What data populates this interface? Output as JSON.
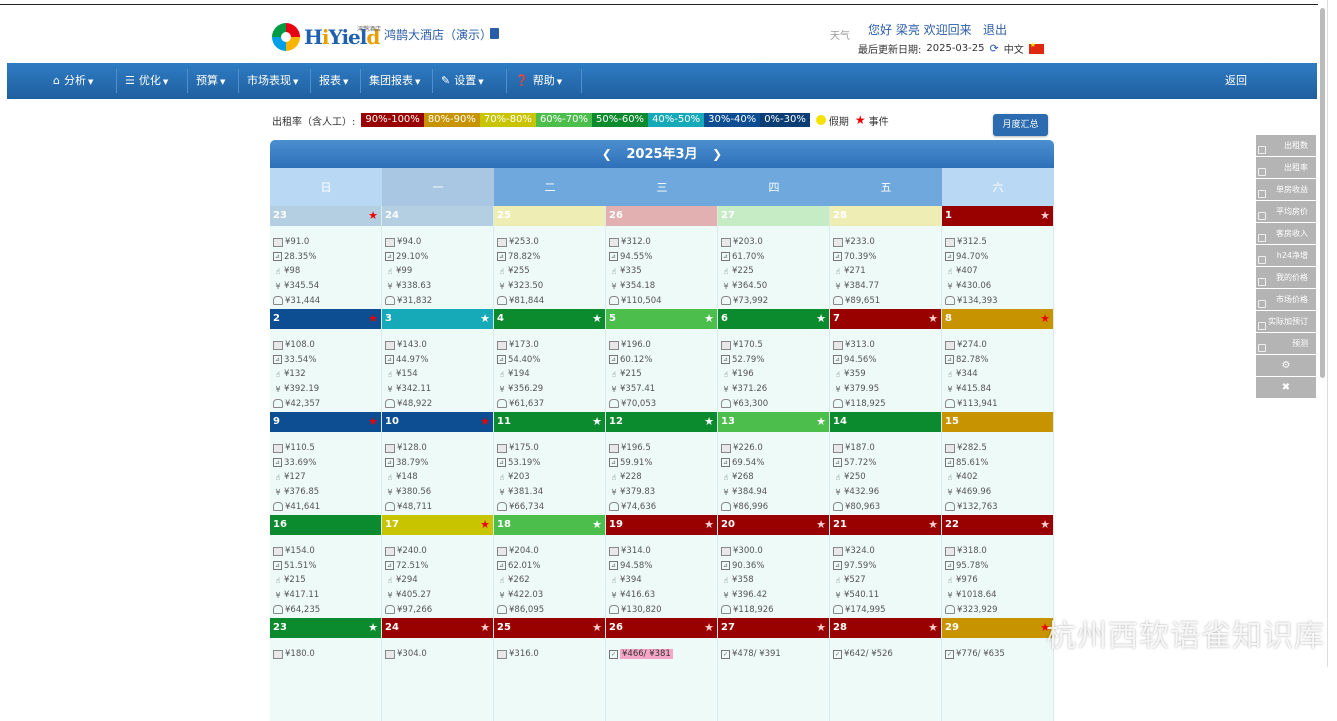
{
  "header": {
    "logo_text_a": "H",
    "logo_text_b": "i",
    "logo_text_c": "Yiel",
    "logo_text_d": "d",
    "logo_sub": "鸿鹊酒店",
    "hotel_name": "鸿鹊大酒店（演示）",
    "weather": "天气",
    "greeting": "您好 梁亮 欢迎回来",
    "logout": "退出",
    "update_label": "最后更新日期:",
    "update_date": "2025-03-25",
    "language": "中文"
  },
  "nav": {
    "items": [
      {
        "label": "分析",
        "icon": "home-icon",
        "glyph": "⌂"
      },
      {
        "label": "优化",
        "icon": "list-icon",
        "glyph": "☰"
      },
      {
        "label": "预算",
        "icon": "",
        "glyph": ""
      },
      {
        "label": "市场表现",
        "icon": "",
        "glyph": ""
      },
      {
        "label": "报表",
        "icon": "",
        "glyph": ""
      },
      {
        "label": "集团报表",
        "icon": "",
        "glyph": ""
      },
      {
        "label": "设置",
        "icon": "wrench-icon",
        "glyph": "✎"
      },
      {
        "label": "帮助",
        "icon": "question-icon",
        "glyph": "❓"
      }
    ],
    "back": "返回"
  },
  "legend": {
    "label": "出租率（含人工）:",
    "ranges": [
      {
        "label": "90%-100%",
        "color": "#990000"
      },
      {
        "label": "80%-90%",
        "color": "#c79400"
      },
      {
        "label": "70%-80%",
        "color": "#c9c400"
      },
      {
        "label": "60%-70%",
        "color": "#4cbe4c"
      },
      {
        "label": "50%-60%",
        "color": "#0b8a2e"
      },
      {
        "label": "40%-50%",
        "color": "#16a9b8"
      },
      {
        "label": "30%-40%",
        "color": "#0d4e93"
      },
      {
        "label": "0%-30%",
        "color": "#0a3d74"
      }
    ],
    "holiday": "假期",
    "event": "事件"
  },
  "month_summary": "月度汇总",
  "calendar": {
    "title": "2025年3月",
    "weekdays": [
      {
        "label": "日",
        "color": "#b9d8f3"
      },
      {
        "label": "一",
        "color": "#a9c6e2"
      },
      {
        "label": "二",
        "color": "#6fa8dc"
      },
      {
        "label": "三",
        "color": "#6fa8dc"
      },
      {
        "label": "四",
        "color": "#6fa8dc"
      },
      {
        "label": "五",
        "color": "#6fa8dc"
      },
      {
        "label": "六",
        "color": "#b9d8f3"
      }
    ],
    "days": [
      {
        "day": "23",
        "color": "#b4cfe2",
        "star": true,
        "dim": true,
        "l": [
          "¥91.0",
          "28.35%",
          "¥98",
          "¥345.54",
          "¥31,444"
        ]
      },
      {
        "day": "24",
        "color": "#b4cfe2",
        "star": false,
        "dim": true,
        "l": [
          "¥94.0",
          "29.10%",
          "¥99",
          "¥338.63",
          "¥31,832"
        ]
      },
      {
        "day": "25",
        "color": "#eeeeb4",
        "star": false,
        "dim": true,
        "l": [
          "¥253.0",
          "78.82%",
          "¥255",
          "¥323.50",
          "¥81,844"
        ]
      },
      {
        "day": "26",
        "color": "#e2b0b0",
        "star": false,
        "dim": true,
        "l": [
          "¥312.0",
          "94.55%",
          "¥335",
          "¥354.18",
          "¥110,504"
        ]
      },
      {
        "day": "27",
        "color": "#c6ecc6",
        "star": false,
        "dim": true,
        "l": [
          "¥203.0",
          "61.70%",
          "¥225",
          "¥364.50",
          "¥73,992"
        ]
      },
      {
        "day": "28",
        "color": "#eeeeb4",
        "star": false,
        "dim": true,
        "l": [
          "¥233.0",
          "70.39%",
          "¥271",
          "¥384.77",
          "¥89,651"
        ]
      },
      {
        "day": "1",
        "color": "#990000",
        "star": true,
        "l": [
          "¥312.5",
          "94.70%",
          "¥407",
          "¥430.06",
          "¥134,393"
        ]
      },
      {
        "day": "2",
        "color": "#0d4e93",
        "star": true,
        "l": [
          "¥108.0",
          "33.54%",
          "¥132",
          "¥392.19",
          "¥42,357"
        ]
      },
      {
        "day": "3",
        "color": "#16a9b8",
        "star": true,
        "l": [
          "¥143.0",
          "44.97%",
          "¥154",
          "¥342.11",
          "¥48,922"
        ]
      },
      {
        "day": "4",
        "color": "#0b8a2e",
        "star": true,
        "l": [
          "¥173.0",
          "54.40%",
          "¥194",
          "¥356.29",
          "¥61,637"
        ]
      },
      {
        "day": "5",
        "color": "#4cbe4c",
        "star": true,
        "l": [
          "¥196.0",
          "60.12%",
          "¥215",
          "¥357.41",
          "¥70,053"
        ]
      },
      {
        "day": "6",
        "color": "#0b8a2e",
        "star": true,
        "l": [
          "¥170.5",
          "52.79%",
          "¥196",
          "¥371.26",
          "¥63,300"
        ]
      },
      {
        "day": "7",
        "color": "#990000",
        "star": true,
        "l": [
          "¥313.0",
          "94.56%",
          "¥359",
          "¥379.95",
          "¥118,925"
        ]
      },
      {
        "day": "8",
        "color": "#c79400",
        "star": true,
        "l": [
          "¥274.0",
          "82.78%",
          "¥344",
          "¥415.84",
          "¥113,941"
        ]
      },
      {
        "day": "9",
        "color": "#0d4e93",
        "star": true,
        "l": [
          "¥110.5",
          "33.69%",
          "¥127",
          "¥376.85",
          "¥41,641"
        ]
      },
      {
        "day": "10",
        "color": "#0d4e93",
        "star": true,
        "l": [
          "¥128.0",
          "38.79%",
          "¥148",
          "¥380.56",
          "¥48,711"
        ]
      },
      {
        "day": "11",
        "color": "#0b8a2e",
        "star": true,
        "l": [
          "¥175.0",
          "53.19%",
          "¥203",
          "¥381.34",
          "¥66,734"
        ]
      },
      {
        "day": "12",
        "color": "#0b8a2e",
        "star": true,
        "l": [
          "¥196.5",
          "59.91%",
          "¥228",
          "¥379.83",
          "¥74,636"
        ]
      },
      {
        "day": "13",
        "color": "#4cbe4c",
        "star": true,
        "l": [
          "¥226.0",
          "69.54%",
          "¥268",
          "¥384.94",
          "¥86,996"
        ]
      },
      {
        "day": "14",
        "color": "#0b8a2e",
        "star": false,
        "l": [
          "¥187.0",
          "57.72%",
          "¥250",
          "¥432.96",
          "¥80,963"
        ]
      },
      {
        "day": "15",
        "color": "#c79400",
        "star": false,
        "l": [
          "¥282.5",
          "85.61%",
          "¥402",
          "¥469.96",
          "¥132,763"
        ]
      },
      {
        "day": "16",
        "color": "#0b8a2e",
        "star": false,
        "l": [
          "¥154.0",
          "51.51%",
          "¥215",
          "¥417.11",
          "¥64,235"
        ]
      },
      {
        "day": "17",
        "color": "#c9c400",
        "star": true,
        "l": [
          "¥240.0",
          "72.51%",
          "¥294",
          "¥405.27",
          "¥97,266"
        ]
      },
      {
        "day": "18",
        "color": "#4cbe4c",
        "star": true,
        "l": [
          "¥204.0",
          "62.01%",
          "¥262",
          "¥422.03",
          "¥86,095"
        ]
      },
      {
        "day": "19",
        "color": "#990000",
        "star": true,
        "l": [
          "¥314.0",
          "94.58%",
          "¥394",
          "¥416.63",
          "¥130,820"
        ]
      },
      {
        "day": "20",
        "color": "#990000",
        "star": true,
        "l": [
          "¥300.0",
          "90.36%",
          "¥358",
          "¥396.42",
          "¥118,926"
        ]
      },
      {
        "day": "21",
        "color": "#990000",
        "star": true,
        "l": [
          "¥324.0",
          "97.59%",
          "¥527",
          "¥540.11",
          "¥174,995"
        ]
      },
      {
        "day": "22",
        "color": "#990000",
        "star": true,
        "l": [
          "¥318.0",
          "95.78%",
          "¥976",
          "¥1018.64",
          "¥323,929"
        ]
      },
      {
        "day": "23",
        "color": "#0b8a2e",
        "star": true,
        "l": [
          "¥180.0"
        ]
      },
      {
        "day": "24",
        "color": "#990000",
        "star": true,
        "l": [
          "¥304.0"
        ]
      },
      {
        "day": "25",
        "color": "#990000",
        "star": true,
        "l": [
          "¥316.0"
        ]
      },
      {
        "day": "26",
        "color": "#990000",
        "star": true,
        "l": [
          "¥466/ ¥381"
        ],
        "pink": true,
        "box": true
      },
      {
        "day": "27",
        "color": "#990000",
        "star": true,
        "l": [
          "¥478/ ¥391"
        ],
        "box": true
      },
      {
        "day": "28",
        "color": "#990000",
        "star": true,
        "l": [
          "¥642/ ¥526"
        ],
        "box": true
      },
      {
        "day": "29",
        "color": "#c79400",
        "star": true,
        "l": [
          "¥776/ ¥635"
        ],
        "box": true
      }
    ]
  },
  "sidebar": [
    "出租数",
    "出租率",
    "单房收益",
    "平均房价",
    "客房收入",
    "h24净增",
    "我的价格",
    "市场价格",
    "实际加预订",
    "预测"
  ],
  "sidebar_icons": {
    "settings": "⚙",
    "close": "✖"
  },
  "watermark": "杭州西软语雀知识库"
}
